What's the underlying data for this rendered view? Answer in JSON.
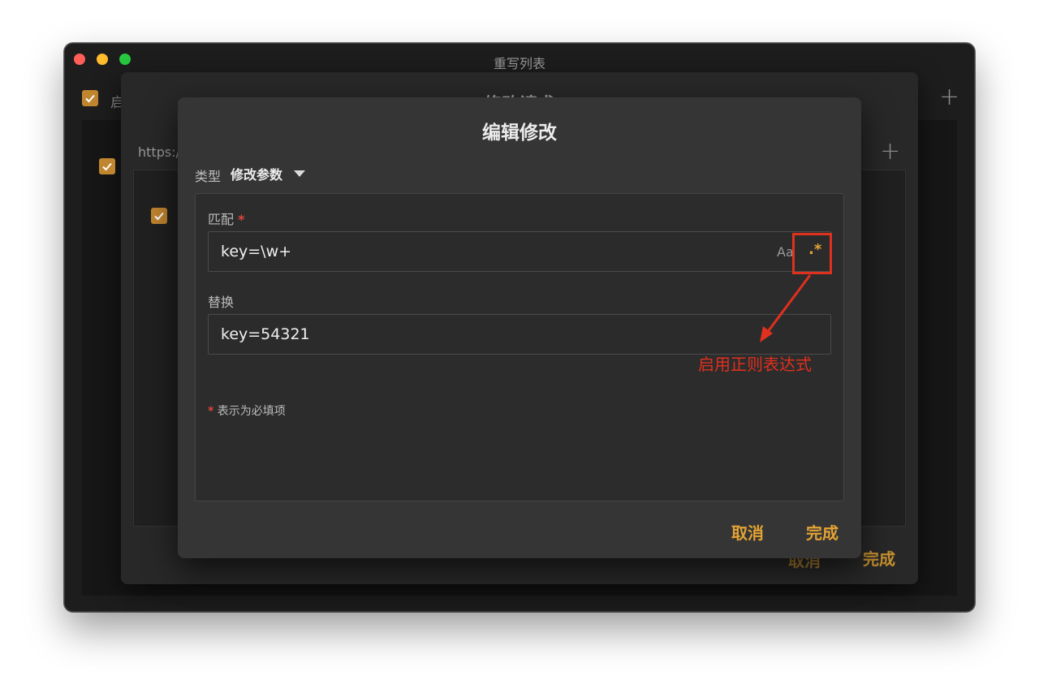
{
  "window": {
    "title": "重写列表",
    "behind_enable_label_partial": "启",
    "behind_url_partial": "https:/"
  },
  "sheet": {
    "title": "修改请求",
    "cancel_label": "取消",
    "done_label": "完成"
  },
  "dialog": {
    "title": "编辑修改",
    "type_label": "类型",
    "type_value": "修改参数",
    "match": {
      "label": "匹配",
      "required_mark": "*",
      "value": "key=\\w+",
      "case_toggle_label": "Aa",
      "regex_toggle_label": ".*"
    },
    "replace": {
      "label": "替换",
      "value": "key=54321"
    },
    "required_note_mark": "*",
    "required_note": "表示为必填项",
    "cancel_label": "取消",
    "done_label": "完成"
  },
  "annotation": {
    "text": "启用正则表达式",
    "color": "#e0301e"
  },
  "colors": {
    "accent": "#e4a334",
    "checkbox": "#c0852f",
    "required": "#e0453a"
  }
}
